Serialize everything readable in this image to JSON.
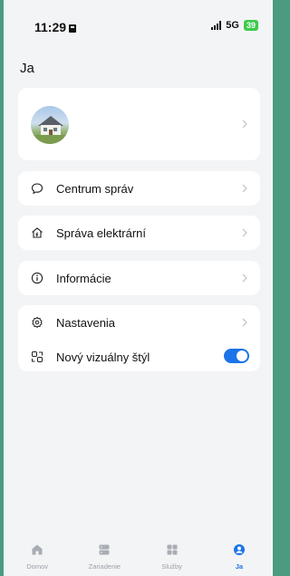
{
  "status": {
    "time": "11:29",
    "network": "5G",
    "battery": "39"
  },
  "page": {
    "title": "Ja"
  },
  "menu": {
    "centrum": "Centrum správ",
    "sprava": "Správa elektrární",
    "info": "Informácie",
    "nastavenia": "Nastavenia",
    "novy_styl": "Nový vizuálny štýl",
    "novy_styl_enabled": true
  },
  "tabs": [
    {
      "label": "Domov",
      "icon": "home-icon"
    },
    {
      "label": "Zariadenie",
      "icon": "device-icon"
    },
    {
      "label": "Služby",
      "icon": "services-grid-icon"
    },
    {
      "label": "Ja",
      "icon": "profile-icon",
      "active": true
    }
  ],
  "colors": {
    "accent": "#1b74e8",
    "battery": "#3ccb4a",
    "background": "#f3f4f6"
  }
}
